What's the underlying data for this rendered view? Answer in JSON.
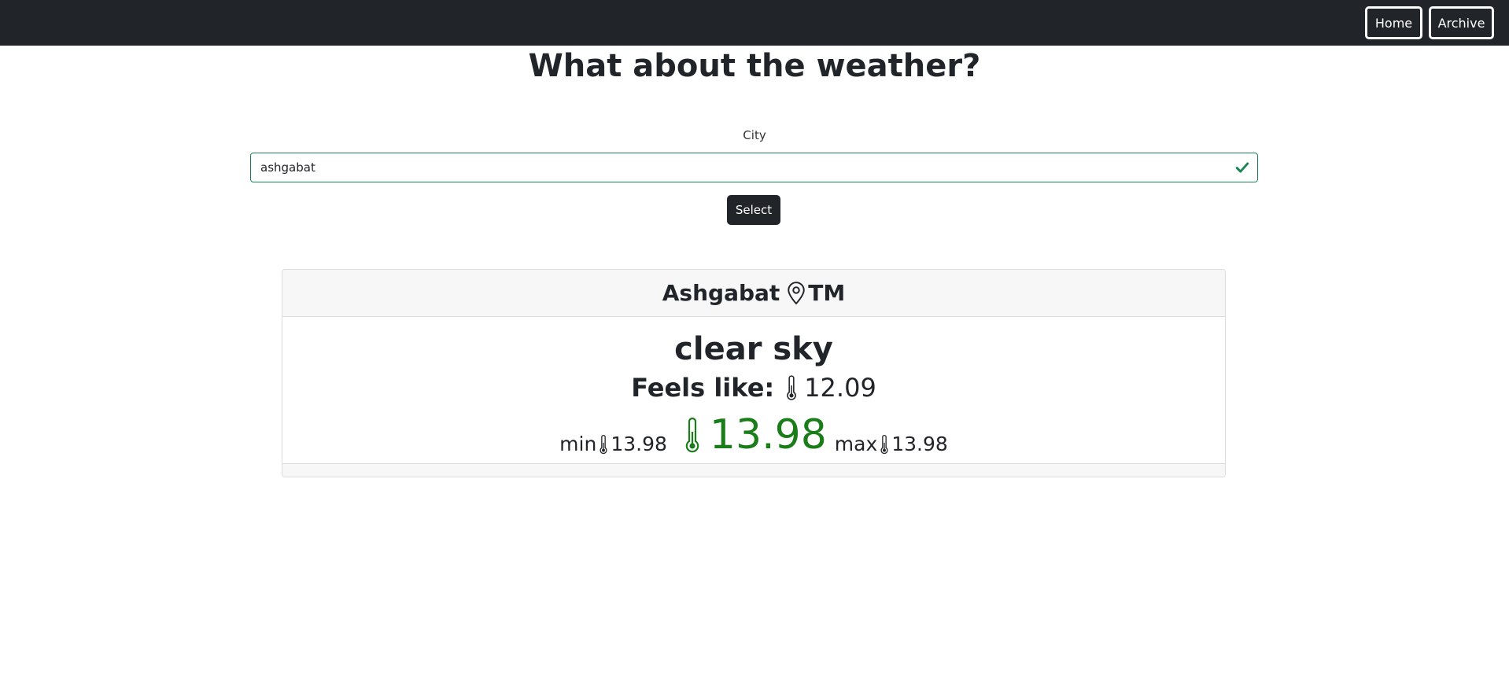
{
  "nav": {
    "home_label": "Home",
    "archive_label": "Archive"
  },
  "page": {
    "title": "What about the weather?"
  },
  "form": {
    "city_label": "City",
    "city_value": "ashgabat",
    "select_label": "Select",
    "valid_color": "#198754"
  },
  "weather_card": {
    "city": "Ashgabat",
    "country": "TM",
    "description": "clear sky",
    "feels_like_label": "Feels like:",
    "feels_like_value": "12.09",
    "min_label": "min",
    "min_value": "13.98",
    "current_value": "13.98",
    "max_label": "max",
    "max_value": "13.98",
    "current_color": "#1a7d1a"
  },
  "icons": {
    "location": "geo-alt-icon",
    "thermometer": "thermometer-icon",
    "valid": "check-icon"
  }
}
